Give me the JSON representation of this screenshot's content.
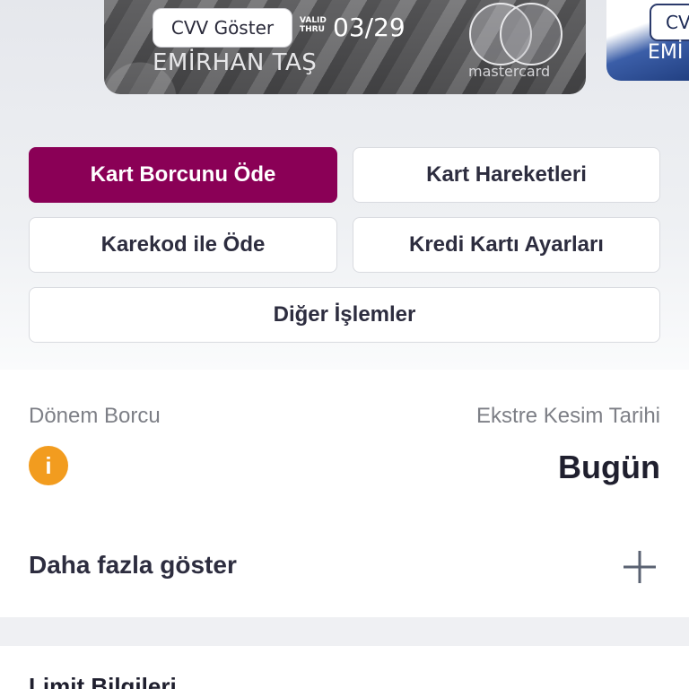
{
  "card": {
    "cvv_button": "CVV Göster",
    "valid_thru": "VALID THRU",
    "expiry": "03/29",
    "holder_name": "EMİRHAN TAŞ",
    "brand": "mastercard"
  },
  "card2": {
    "cvv_button": "CV",
    "name_partial": "EMİ"
  },
  "actions": {
    "pay_debt": "Kart Borcunu Öde",
    "transactions": "Kart Hareketleri",
    "qr_pay": "Karekod ile Öde",
    "settings": "Kredi Kartı Ayarları",
    "other": "Diğer İşlemler"
  },
  "summary": {
    "period_debt_label": "Dönem Borcu",
    "statement_date_label": "Ekstre Kesim Tarihi",
    "statement_date_value": "Bugün",
    "info_icon": "info-icon"
  },
  "more": {
    "label": "Daha fazla göster",
    "icon": "plus-icon"
  },
  "limit": {
    "title": "Limit Bilgileri"
  },
  "colors": {
    "primary": "#8a0056",
    "info": "#f29c1f"
  }
}
